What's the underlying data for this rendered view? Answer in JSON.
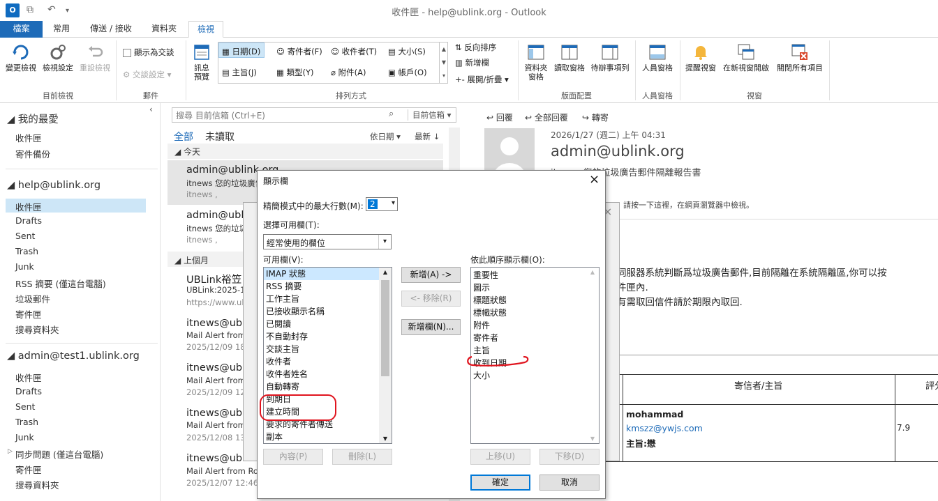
{
  "window": {
    "title": "收件匣 - help@ublink.org - Outlook",
    "app_icon": "O"
  },
  "tabs": [
    "檔案",
    "常用",
    "傳送 / 接收",
    "資料夾",
    "檢視"
  ],
  "ribbon": {
    "current_view": {
      "change": "變更檢視",
      "settings": "檢視設定",
      "reset": "重設檢視",
      "group": "目前檢視"
    },
    "messages": {
      "show_conv": "顯示為交談",
      "conv_settings": "交談設定",
      "group": "郵件"
    },
    "arrangement": {
      "preview": "訊息\n預覽",
      "opts": [
        [
          "日期(D)",
          "寄件者(F)",
          "收件者(T)",
          "大小(S)"
        ],
        [
          "主旨(J)",
          "類型(Y)",
          "附件(A)",
          "帳戶(O)"
        ]
      ],
      "reverse": "反向排序",
      "add_cols": "新增欄",
      "expand": "展開/折疊",
      "group": "排列方式"
    },
    "layout": {
      "folder_pane": "資料夾\n窗格",
      "reading_pane": "讀取窗格",
      "todo": "待辦事項列",
      "group": "版面配置"
    },
    "people": {
      "people_pane": "人員窗格",
      "group": "人員窗格"
    },
    "window": {
      "reminders": "提醒視窗",
      "open_new": "在新視窗開啟",
      "close_all": "關閉所有項目",
      "group": "視窗"
    }
  },
  "nav": {
    "favorites": "我的最愛",
    "fav_items": [
      "收件匣",
      "寄件備份"
    ],
    "acct1": "help@ublink.org",
    "acct1_items": [
      "收件匣",
      "Drafts",
      "Sent",
      "Trash",
      "Junk",
      "RSS 摘要 (僅這台電腦)",
      "垃圾郵件",
      "寄件匣",
      "搜尋資料夾"
    ],
    "acct2": "admin@test1.ublink.org",
    "acct2_items": [
      "收件匣",
      "Drafts",
      "Sent",
      "Trash",
      "Junk",
      "同步問題 (僅這台電腦)",
      "寄件匣",
      "搜尋資料夾"
    ]
  },
  "list": {
    "search_placeholder": "搜尋 目前信箱 (Ctrl+E)",
    "scope": "目前信箱",
    "filter_all": "全部",
    "filter_unread": "未讀取",
    "sort_by": "依日期",
    "sort_order": "最新",
    "group_today": "今天",
    "group_last_month": "上個月",
    "messages": [
      {
        "sender": "admin@ublink.org",
        "subject": "itnews 您的垃圾廣告",
        "date": "itnews ,"
      },
      {
        "sender": "admin@ublink.org",
        "subject": "itnews 您的垃圾",
        "date": "itnews ,"
      },
      {
        "sender": "UBLink裕笠",
        "subject": "UBLink:2025-1",
        "date": "https://www.ubl"
      },
      {
        "sender": "itnews@ub",
        "subject": "Mail Alert from",
        "date": "2025/12/09 18"
      },
      {
        "sender": "itnews@ub",
        "subject": "Mail Alert from",
        "date": "2025/12/09 12"
      },
      {
        "sender": "itnews@ub",
        "subject": "Mail Alert from",
        "date": "2025/12/08 13"
      },
      {
        "sender": "itnews@ub",
        "subject": "Mail Alert from Ro",
        "date": "2025/12/07 12:46"
      }
    ]
  },
  "reading": {
    "reply": "回覆",
    "reply_all": "全部回覆",
    "forward": "轉寄",
    "datetime": "2026/1/27 (週二) 上午 04:31",
    "from": "admin@ublink.org",
    "subject": "itnews 您的垃圾廣告郵件隔離報告書",
    "infobar": "請按一下這裡，在網頁瀏覽器中檢視。",
    "body1": "伺服器系統判斷爲垃圾廣告郵件,目前隔離在系統隔離區,你可以按",
    "body2": "件匣內.",
    "body3": "有需取回信件請於期限內取回.",
    "table_header": "寄信者/主旨",
    "table_header2": "評分",
    "row_name": "mohammad",
    "row_email": "kmszz@ywjs.com",
    "row_subject": "主旨:懋",
    "row_score": "7.9"
  },
  "dialog": {
    "title": "顯示欄",
    "max_lines_label": "精簡模式中的最大行數(M):",
    "max_lines_value": "2",
    "select_label": "選擇可用欄(T):",
    "select_value": "經常使用的欄位",
    "available_label": "可用欄(V):",
    "available": [
      "IMAP 狀態",
      "RSS 摘要",
      "工作主旨",
      "已接收顯示名稱",
      "已閱讀",
      "不自動封存",
      "交談主旨",
      "收件者",
      "收件者姓名",
      "自動轉寄",
      "到期日",
      "建立時間",
      "要求的寄件者傳送",
      "副本"
    ],
    "order_label": "依此順序顯示欄(O):",
    "order": [
      "重要性",
      "圖示",
      "標題狀態",
      "標幟狀態",
      "附件",
      "寄件者",
      "主旨",
      "收到日期",
      "大小"
    ],
    "add_btn": "新增(A) ->",
    "remove_btn": "<- 移除(R)",
    "new_col_btn": "新增欄(N)...",
    "props_btn": "內容(P)",
    "delete_btn": "刪除(L)",
    "up_btn": "上移(U)",
    "down_btn": "下移(D)",
    "ok_btn": "確定",
    "cancel_btn": "取消"
  },
  "colors": {
    "accent": "#1e6bb8",
    "selection": "#cde6f7",
    "annotation": "#e0141e"
  }
}
